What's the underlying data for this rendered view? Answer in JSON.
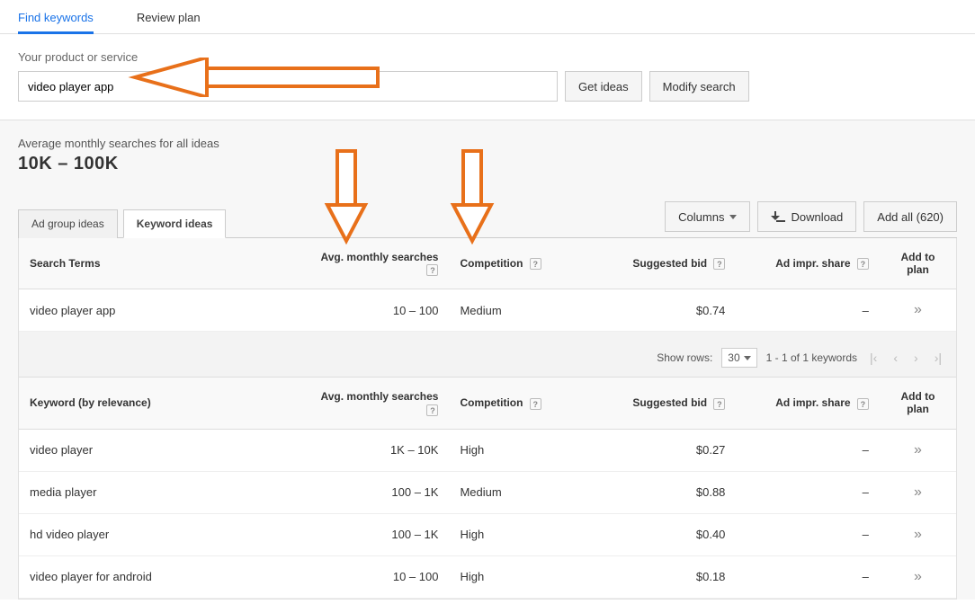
{
  "topTabs": {
    "find": "Find keywords",
    "review": "Review plan"
  },
  "search": {
    "label": "Your product or service",
    "value": "video player app",
    "getIdeas": "Get ideas",
    "modify": "Modify search"
  },
  "avg": {
    "label": "Average monthly searches for all ideas",
    "value": "10K – 100K"
  },
  "ideasTabs": {
    "adGroup": "Ad group ideas",
    "keyword": "Keyword ideas"
  },
  "actions": {
    "columns": "Columns",
    "download": "Download",
    "addAll": "Add all (620)"
  },
  "headers": {
    "searchTerms": "Search Terms",
    "keywordRel": "Keyword (by relevance)",
    "avgMonthly": "Avg. monthly searches",
    "competition": "Competition",
    "bid": "Suggested bid",
    "share": "Ad impr. share",
    "add": "Add to plan"
  },
  "helpGlyph": "?",
  "searchTermsRows": [
    {
      "term": "video player app",
      "avg": "10 – 100",
      "comp": "Medium",
      "bid": "$0.74",
      "share": "–"
    }
  ],
  "pager": {
    "showRows": "Show rows:",
    "perPage": "30",
    "range": "1 - 1 of 1 keywords"
  },
  "keywordRows": [
    {
      "term": "video player",
      "avg": "1K – 10K",
      "comp": "High",
      "bid": "$0.27",
      "share": "–"
    },
    {
      "term": "media player",
      "avg": "100 – 1K",
      "comp": "Medium",
      "bid": "$0.88",
      "share": "–"
    },
    {
      "term": "hd video player",
      "avg": "100 – 1K",
      "comp": "High",
      "bid": "$0.40",
      "share": "–"
    },
    {
      "term": "video player for android",
      "avg": "10 – 100",
      "comp": "High",
      "bid": "$0.18",
      "share": "–"
    }
  ],
  "addGlyph": "»"
}
